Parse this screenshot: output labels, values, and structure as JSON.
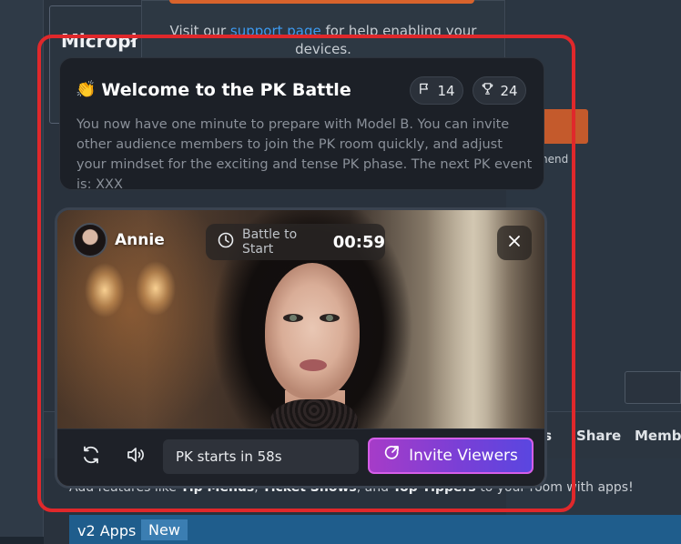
{
  "background": {
    "microphone_title": "Micropł",
    "help_text_prefix": "Visit our",
    "help_link": "support page",
    "help_text_suffix": "for help enabling your devices.",
    "side_text": "nend",
    "tabs": [
      "ts",
      "Share",
      "Membe"
    ],
    "feature_text_parts": [
      "Add features like ",
      "Tip Menus",
      ", ",
      "Ticket Shows",
      ", and ",
      "Top Tippers",
      " to your room with apps!"
    ],
    "apps_label": "v2 Apps",
    "new_badge": "New"
  },
  "welcome": {
    "emoji": "👏",
    "title": "Welcome to the PK Battle",
    "flag_count": "14",
    "trophy_count": "24",
    "description": "You now have one minute to prepare with Model B. You can invite other audience members to join the PK room quickly, and adjust your mindset for the exciting and tense PK phase. The next PK event is: XXX"
  },
  "battle": {
    "streamer_name": "Annie",
    "timer_label": "Battle to Start",
    "timer_value": "00:59",
    "pk_status": "PK starts in 58s",
    "invite_label": "Invite Viewers"
  },
  "colors": {
    "highlight": "#e0282b",
    "invite_gradient_start": "#a63cc8",
    "invite_gradient_end": "#5a46e0",
    "link": "#3d9af0"
  },
  "icons": {
    "flag": "flag-icon",
    "trophy": "trophy-icon",
    "clock": "clock-icon",
    "close": "close-icon",
    "refresh": "refresh-icon",
    "volume": "volume-icon",
    "invite": "share-arrow-icon"
  }
}
